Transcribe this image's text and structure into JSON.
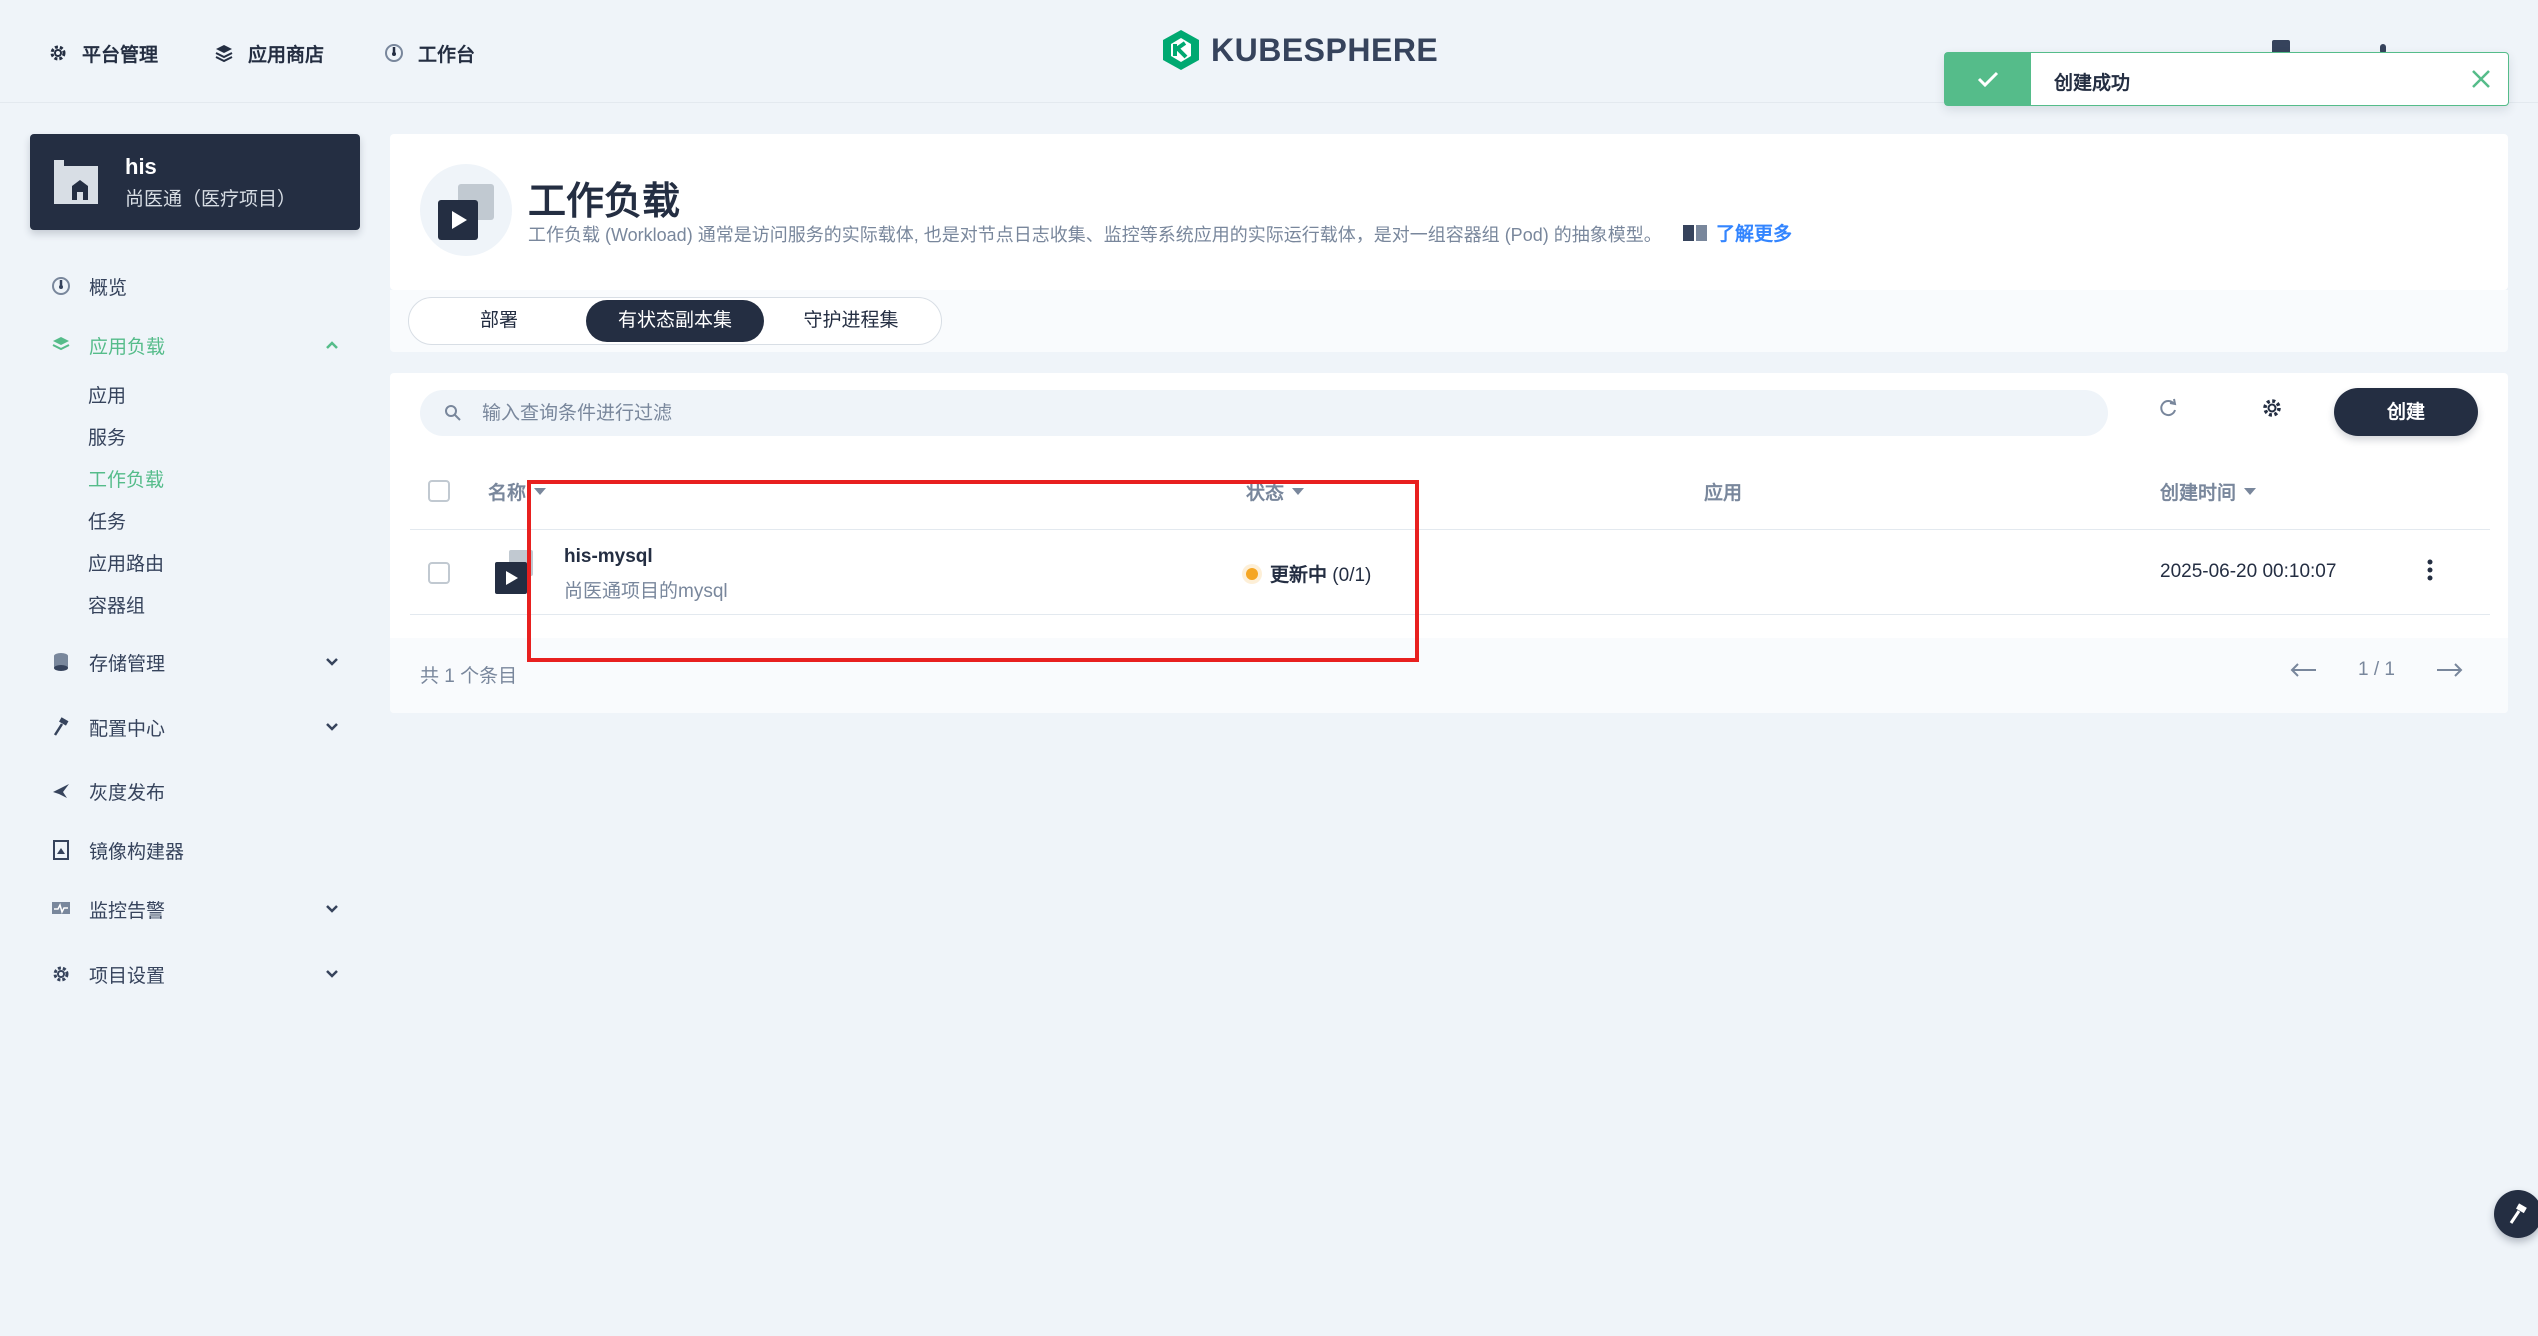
{
  "topnav": {
    "items": [
      {
        "label": "平台管理",
        "icon": "gear-icon"
      },
      {
        "label": "应用商店",
        "icon": "stack-icon"
      },
      {
        "label": "工作台",
        "icon": "dashboard-icon"
      }
    ],
    "logo_text": "KUBESPHERE"
  },
  "toast": {
    "message": "创建成功",
    "status_color": "#55bc8a"
  },
  "project": {
    "name": "his",
    "description": "尚医通（医疗项目）"
  },
  "sidebar": {
    "items": [
      {
        "label": "概览",
        "icon": "dashboard-icon"
      },
      {
        "label": "应用负载",
        "icon": "stack-icon"
      },
      {
        "label": "存储管理",
        "icon": "database-icon"
      },
      {
        "label": "配置中心",
        "icon": "hammer-icon"
      },
      {
        "label": "灰度发布",
        "icon": "bird-icon"
      },
      {
        "label": "镜像构建器",
        "icon": "image-icon"
      },
      {
        "label": "监控告警",
        "icon": "monitor-icon"
      },
      {
        "label": "项目设置",
        "icon": "gear-icon"
      }
    ],
    "subitems": [
      {
        "label": "应用"
      },
      {
        "label": "服务"
      },
      {
        "label": "工作负载"
      },
      {
        "label": "任务"
      },
      {
        "label": "应用路由"
      },
      {
        "label": "容器组"
      }
    ],
    "accent_color": "#55bc8a"
  },
  "header": {
    "title": "工作负载",
    "description": "工作负载 (Workload) 通常是访问服务的实际载体, 也是对节点日志收集、监控等系统应用的实际运行载体，是对一组容器组 (Pod) 的抽象模型。",
    "learn_more": "了解更多"
  },
  "tabs": [
    {
      "label": "部署"
    },
    {
      "label": "有状态副本集"
    },
    {
      "label": "守护进程集"
    }
  ],
  "toolbar": {
    "search_placeholder": "输入查询条件进行过滤",
    "create_label": "创建"
  },
  "table": {
    "columns": {
      "name": "名称",
      "status": "状态",
      "app": "应用",
      "created": "创建时间"
    },
    "rows": [
      {
        "name": "his-mysql",
        "description": "尚医通项目的mysql",
        "status_label": "更新中",
        "status_count": "(0/1)",
        "status_color": "#f5a623",
        "app": "",
        "created": "2025-06-20 00:10:07"
      }
    ],
    "total": "共 1 个条目",
    "page": "1 / 1"
  }
}
